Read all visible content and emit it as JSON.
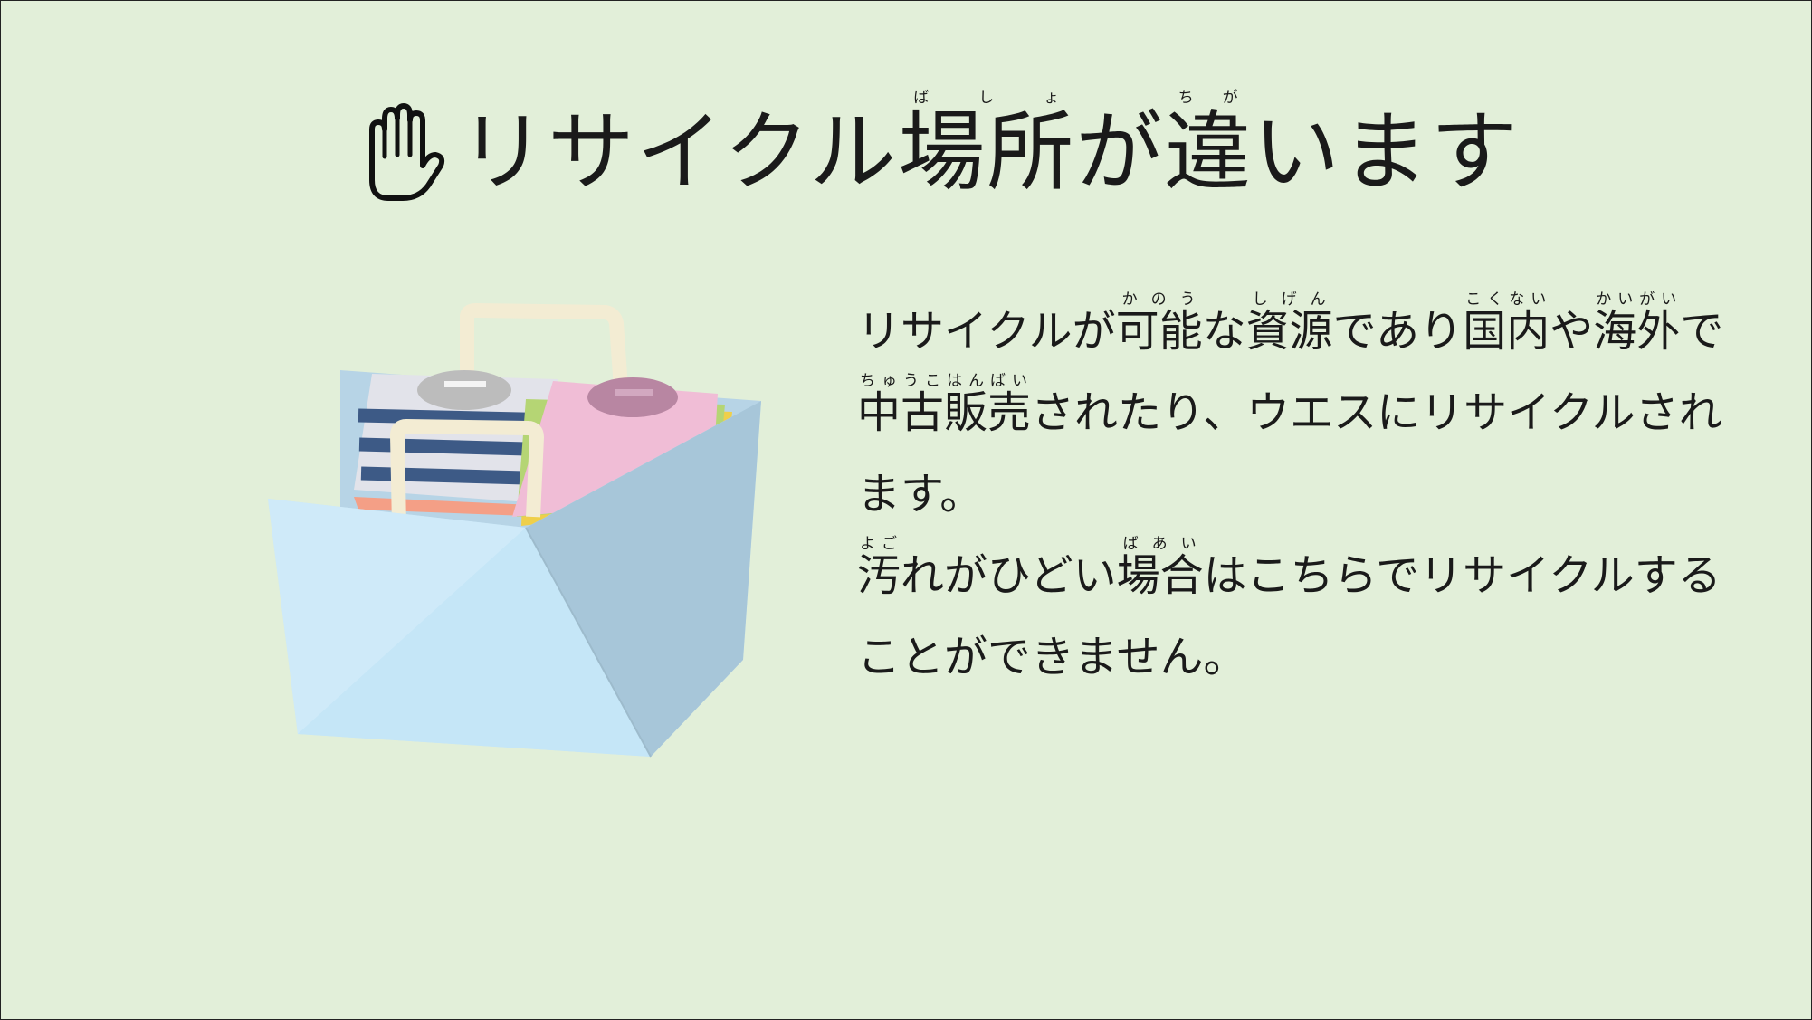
{
  "title": {
    "pre": "リサイクル",
    "w1": "場所",
    "w1_ruby": "ばしょ",
    "mid": "が",
    "w2": "違",
    "w2_ruby": "ちが",
    "post": "います",
    "icon": "hand-stop-icon"
  },
  "paragraph1": {
    "s1": "リサイクルが",
    "w1": "可能",
    "w1_ruby": "かのう",
    "s2": "な",
    "w2": "資源",
    "w2_ruby": "しげん",
    "s3": "であり",
    "w3": "国内",
    "w3_ruby": "こくない",
    "s4": "や",
    "w4": "海外",
    "w4_ruby": "かいがい",
    "s5": "で",
    "w5": "中古販売",
    "w5_ruby": "ちゅうこはんばい",
    "s6": "されたり、ウエスにリサイクルされます。"
  },
  "paragraph2": {
    "w1": "汚",
    "w1_ruby": "よご",
    "s1": "れがひどい",
    "w2": "場合",
    "w2_ruby": "ばあい",
    "s2": "はこちらでリサイクルすることができません。"
  },
  "colors": {
    "background": "#e2efd9",
    "bag": "#c5e6f7",
    "text": "#1a1a1a"
  }
}
